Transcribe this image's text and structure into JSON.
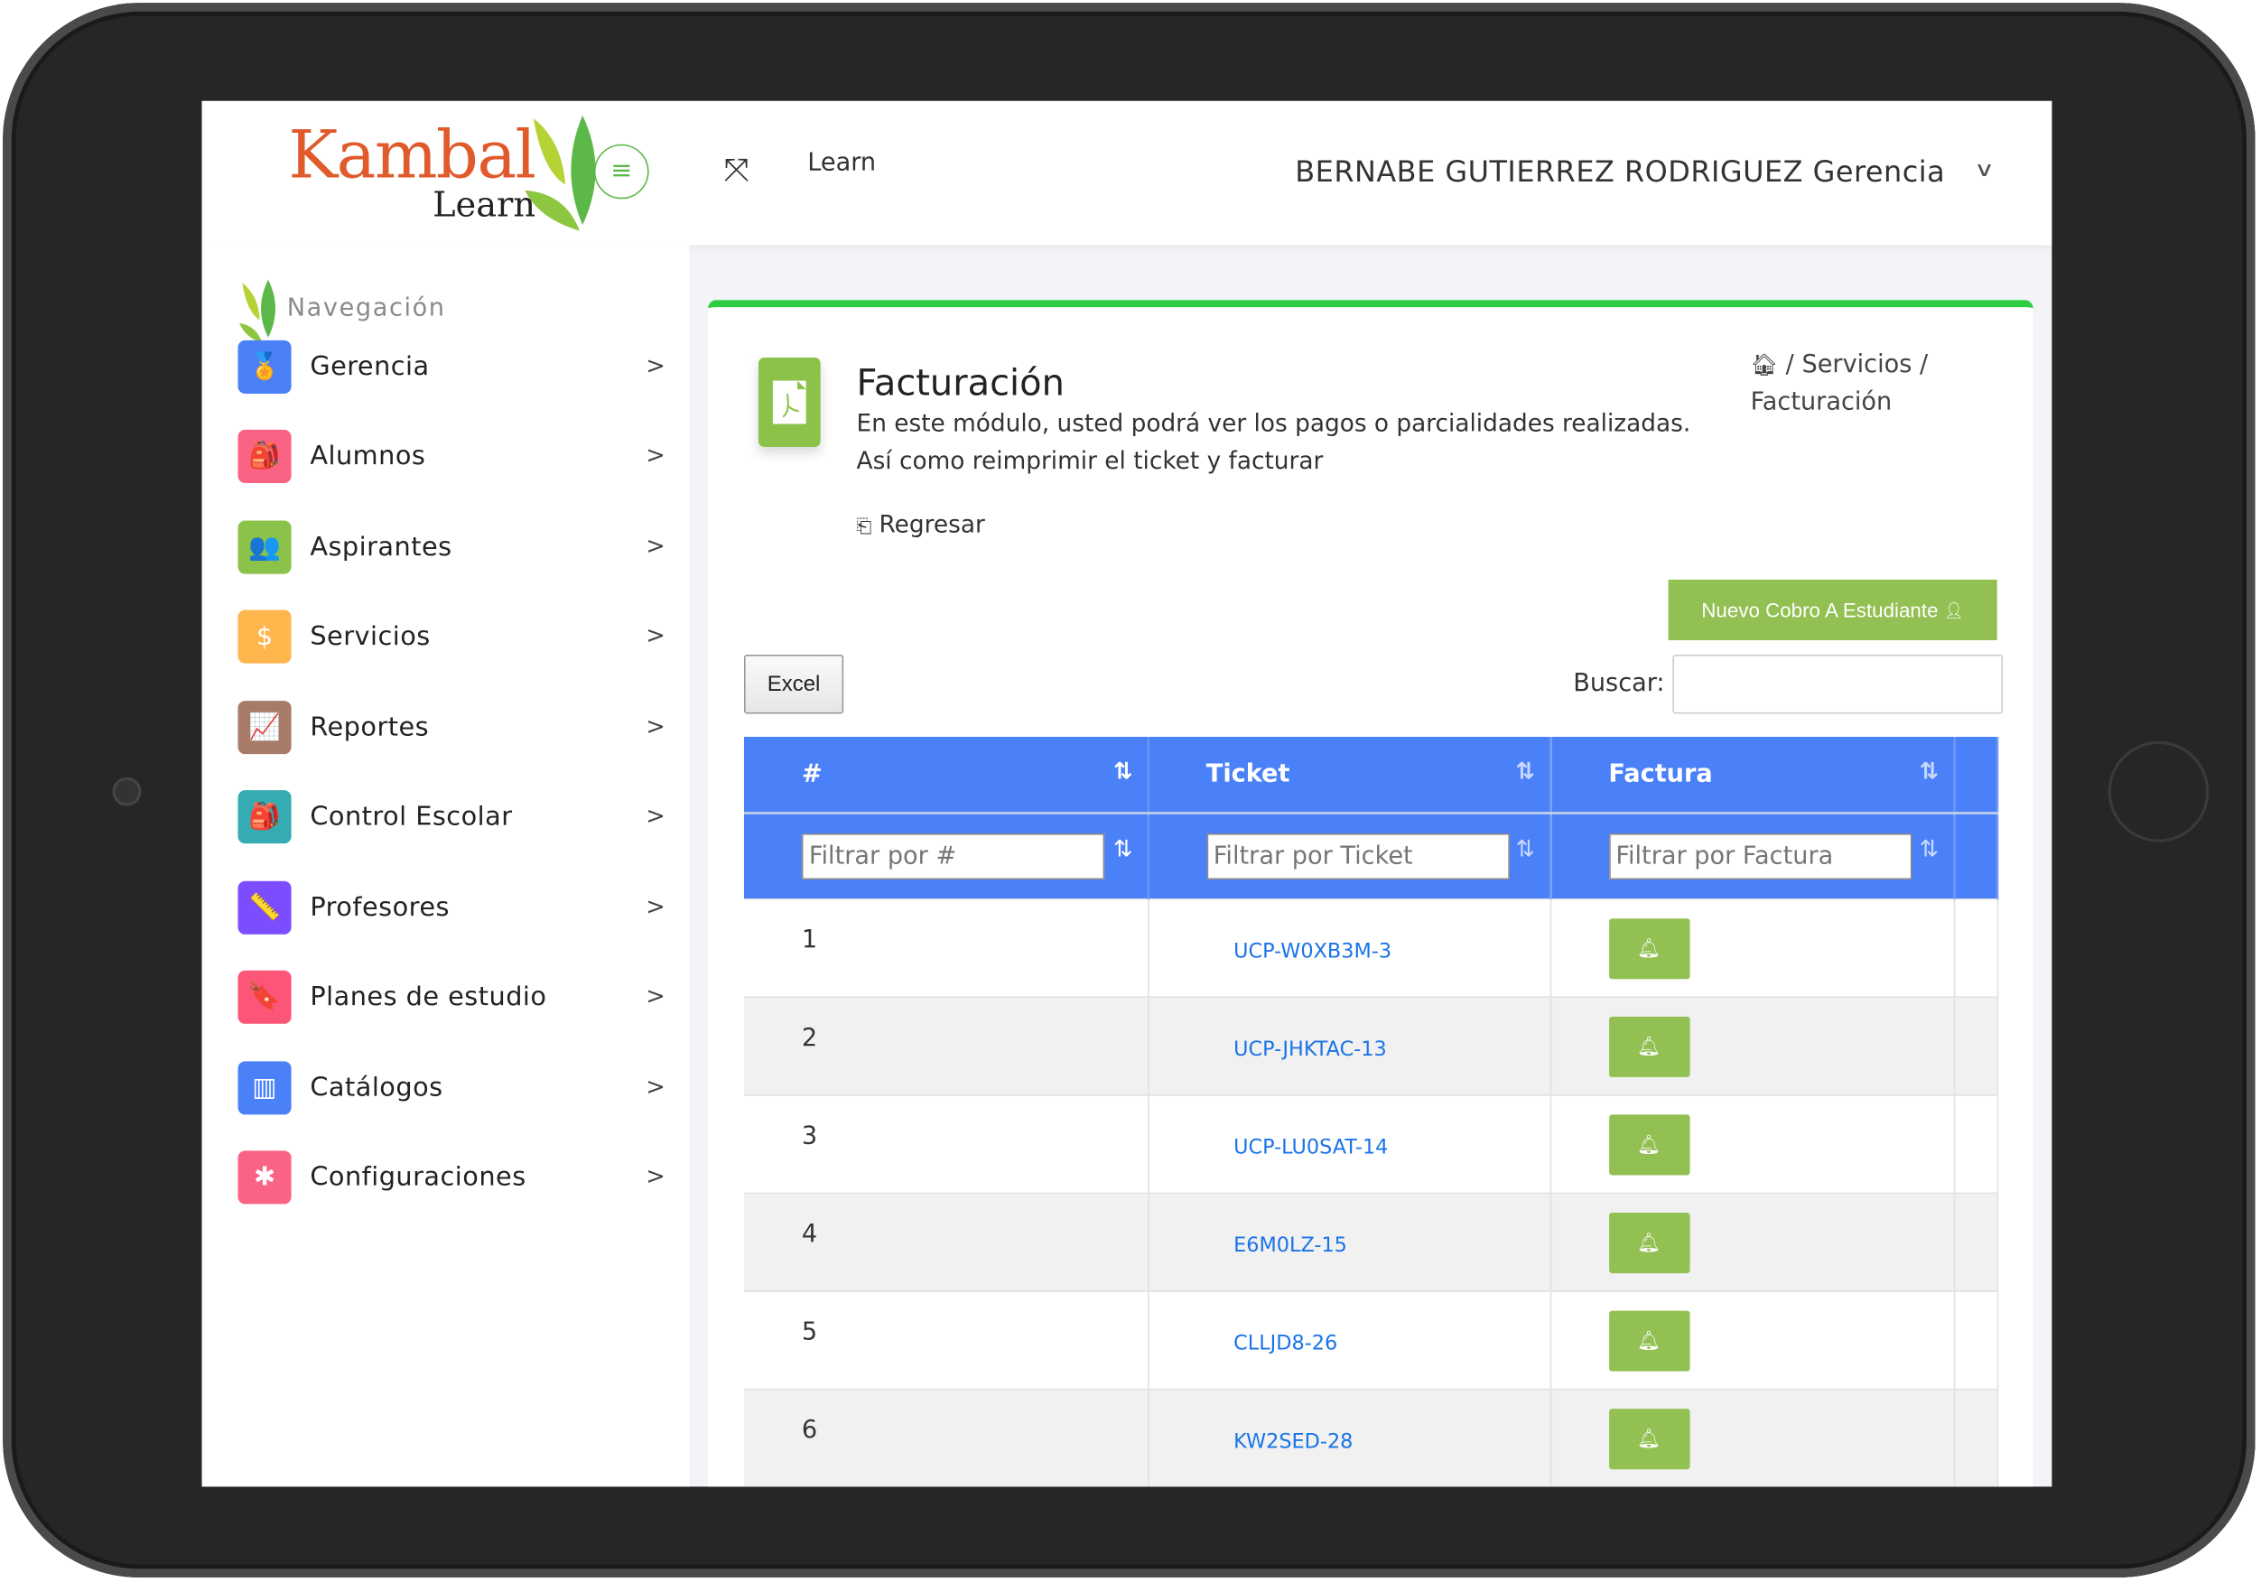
{
  "brand": {
    "logo_main": "Kambal",
    "logo_sub": "Learn"
  },
  "topbar": {
    "app_label": "Learn",
    "user_name": "BERNABE GUTIERREZ RODRIGUEZ Gerencia"
  },
  "sidebar": {
    "heading": "Navegación",
    "items": [
      {
        "label": "Gerencia",
        "icon": "award-icon",
        "color": "#4a80f8",
        "glyph": "🏅"
      },
      {
        "label": "Alumnos",
        "icon": "backpack-icon",
        "color": "#fb6385",
        "glyph": "🎒"
      },
      {
        "label": "Aspirantes",
        "icon": "users-icon",
        "color": "#8bc34a",
        "glyph": "👥"
      },
      {
        "label": "Servicios",
        "icon": "dollar-icon",
        "color": "#ffb64d",
        "glyph": "$"
      },
      {
        "label": "Reportes",
        "icon": "chart-line-icon",
        "color": "#a87a68",
        "glyph": "📈"
      },
      {
        "label": "Control Escolar",
        "icon": "backpack-icon",
        "color": "#35abb3",
        "glyph": "🎒"
      },
      {
        "label": "Profesores",
        "icon": "ruler-pencil-icon",
        "color": "#7c4dff",
        "glyph": "📏"
      },
      {
        "label": "Planes de estudio",
        "icon": "book-icon",
        "color": "#fb5577",
        "glyph": "🔖"
      },
      {
        "label": "Catálogos",
        "icon": "layout-icon",
        "color": "#4a80f8",
        "glyph": "▥"
      },
      {
        "label": "Configuraciones",
        "icon": "magic-wand-icon",
        "color": "#fb6385",
        "glyph": "✱"
      }
    ]
  },
  "page": {
    "title": "Facturación",
    "description": "En este módulo, usted podrá ver los pagos o parcialidades realizadas. Así como reimprimir el ticket y facturar",
    "back_label": "Regresar",
    "breadcrumb": [
      "Servicios",
      "Facturación"
    ],
    "new_button": "Nuevo Cobro A Estudiante",
    "excel_button": "Excel",
    "search_label": "Buscar:",
    "search_value": ""
  },
  "table": {
    "columns": [
      "#",
      "Ticket",
      "Factura"
    ],
    "filters": [
      "Filtrar por #",
      "Filtrar por Ticket",
      "Filtrar por Factura"
    ],
    "rows": [
      {
        "num": "1",
        "ticket": "UCP-W0XB3M-3"
      },
      {
        "num": "2",
        "ticket": "UCP-JHKTAC-13"
      },
      {
        "num": "3",
        "ticket": "UCP-LU0SAT-14"
      },
      {
        "num": "4",
        "ticket": "E6M0LZ-15"
      },
      {
        "num": "5",
        "ticket": "CLLJD8-26"
      },
      {
        "num": "6",
        "ticket": "KW2SED-28"
      }
    ]
  },
  "colors": {
    "accent_blue": "#4a80f8",
    "accent_green": "#92c052",
    "card_top": "#2ecc40",
    "link": "#1a73e8"
  }
}
